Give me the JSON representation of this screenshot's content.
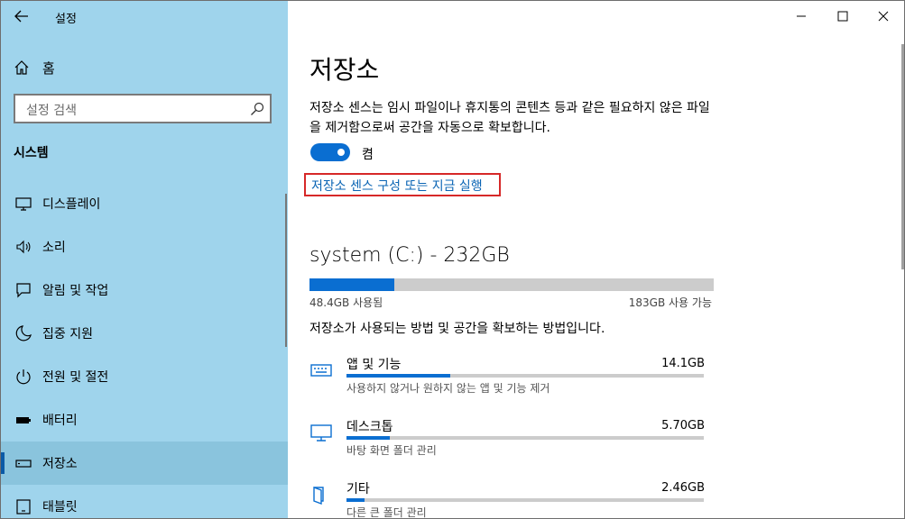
{
  "app": {
    "title": "설정"
  },
  "sidebar": {
    "home_label": "홈",
    "search_placeholder": "설정 검색",
    "section_title": "시스템",
    "items": [
      {
        "label": "디스플레이",
        "icon": "display-icon"
      },
      {
        "label": "소리",
        "icon": "speaker-icon"
      },
      {
        "label": "알림 및 작업",
        "icon": "notification-icon"
      },
      {
        "label": "집중 지원",
        "icon": "moon-icon"
      },
      {
        "label": "전원 및 절전",
        "icon": "power-icon"
      },
      {
        "label": "배터리",
        "icon": "battery-icon"
      },
      {
        "label": "저장소",
        "icon": "storage-icon",
        "selected": true
      },
      {
        "label": "태블릿",
        "icon": "tablet-icon"
      }
    ]
  },
  "main": {
    "title": "저장소",
    "description": "저장소 센스는 임시 파일이나 휴지통의 콘텐츠 등과 같은 필요하지 않은 파일을 제거함으로써 공간을 자동으로 확보합니다.",
    "toggle_state": "켬",
    "toggle_on": true,
    "link": "저장소 센스 구성 또는 지금 실행",
    "drive": {
      "title": "system (C:) - 232GB",
      "used": "48.4GB 사용됨",
      "free": "183GB 사용 가능",
      "used_fraction": 0.209
    },
    "howto": "저장소가 사용되는 방법 및 공간을 확보하는 방법입니다.",
    "categories": [
      {
        "name": "앱 및 기능",
        "size": "14.1GB",
        "sub": "사용하지 않거나 원하지 않는 앱 및 기능 제거",
        "fraction": 0.29,
        "icon": "keyboard-icon"
      },
      {
        "name": "데스크톱",
        "size": "5.70GB",
        "sub": "바탕 화면 폴더 관리",
        "fraction": 0.12,
        "icon": "monitor-icon"
      },
      {
        "name": "기타",
        "size": "2.46GB",
        "sub": "다른 큰 폴더 관리",
        "fraction": 0.05,
        "icon": "folder-icon"
      }
    ]
  },
  "colors": {
    "sidebar_bg": "#9fd4ec",
    "accent": "#0a6ed1",
    "highlight_border": "#d62828",
    "link": "#0a64b4"
  }
}
